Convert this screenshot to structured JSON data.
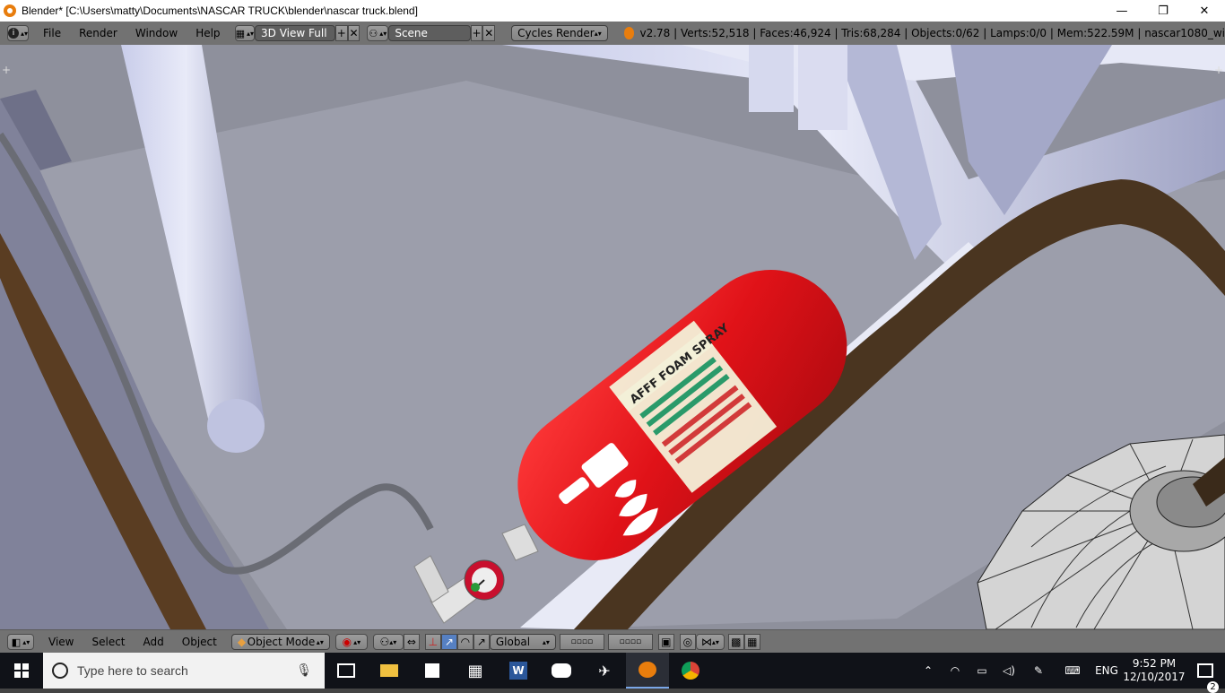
{
  "window": {
    "title": "Blender* [C:\\Users\\matty\\Documents\\NASCAR TRUCK\\blender\\nascar truck.blend]",
    "minimize": "—",
    "maximize": "❐",
    "close": "✕"
  },
  "header": {
    "menus": [
      "File",
      "Render",
      "Window",
      "Help"
    ],
    "screen_layout": "3D View Full",
    "scene": "Scene",
    "render_engine": "Cycles Render",
    "stats": "v2.78 | Verts:52,518 | Faces:46,924 | Tris:68,284 | Objects:0/62 | Lamps:0/0 | Mem:522.59M | nascar1080_wi"
  },
  "viewport": {
    "label_lines": [
      "AFFF FOAM SPRAY"
    ]
  },
  "footer": {
    "menus": [
      "View",
      "Select",
      "Add",
      "Object"
    ],
    "mode": "Object Mode",
    "orientation": "Global"
  },
  "taskbar": {
    "search_placeholder": "Type here to search",
    "language": "ENG",
    "time": "9:52 PM",
    "date": "12/10/2017",
    "notifications": "2"
  },
  "colors": {
    "extinguisher": "#e01218",
    "header_bg": "#727272",
    "taskbar_bg": "#101218"
  }
}
